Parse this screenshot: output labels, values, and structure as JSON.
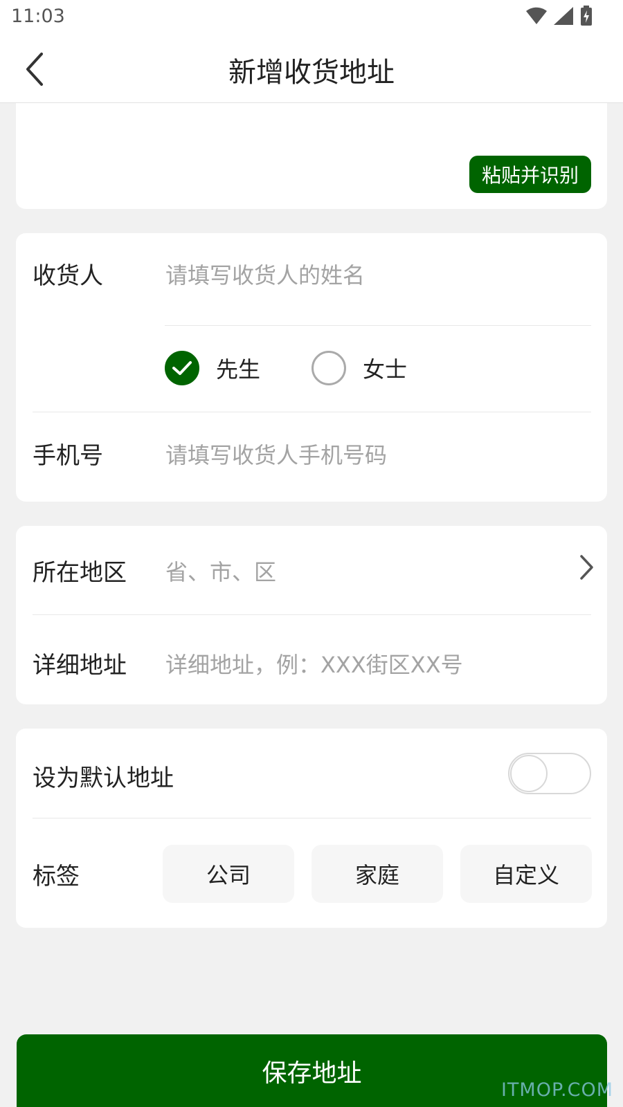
{
  "status_bar": {
    "time": "11:03"
  },
  "header": {
    "title": "新增收货地址"
  },
  "paste": {
    "button_label": "粘贴并识别"
  },
  "recipient": {
    "label": "收货人",
    "placeholder": "请填写收货人的姓名",
    "gender_options": [
      {
        "label": "先生",
        "checked": true
      },
      {
        "label": "女士",
        "checked": false
      }
    ]
  },
  "phone": {
    "label": "手机号",
    "placeholder": "请填写收货人手机号码"
  },
  "region": {
    "label": "所在地区",
    "placeholder": "省、市、区"
  },
  "detail": {
    "label": "详细地址",
    "placeholder": "详细地址，例：XXX街区XX号"
  },
  "default_address": {
    "label": "设为默认地址",
    "enabled": false
  },
  "tags": {
    "label": "标签",
    "options": [
      "公司",
      "家庭",
      "自定义"
    ]
  },
  "save": {
    "button_label": "保存地址"
  },
  "watermark": "ITMOP.COM",
  "colors": {
    "accent": "#006400",
    "background": "#f1f1f1",
    "placeholder": "#a3a3a3"
  }
}
